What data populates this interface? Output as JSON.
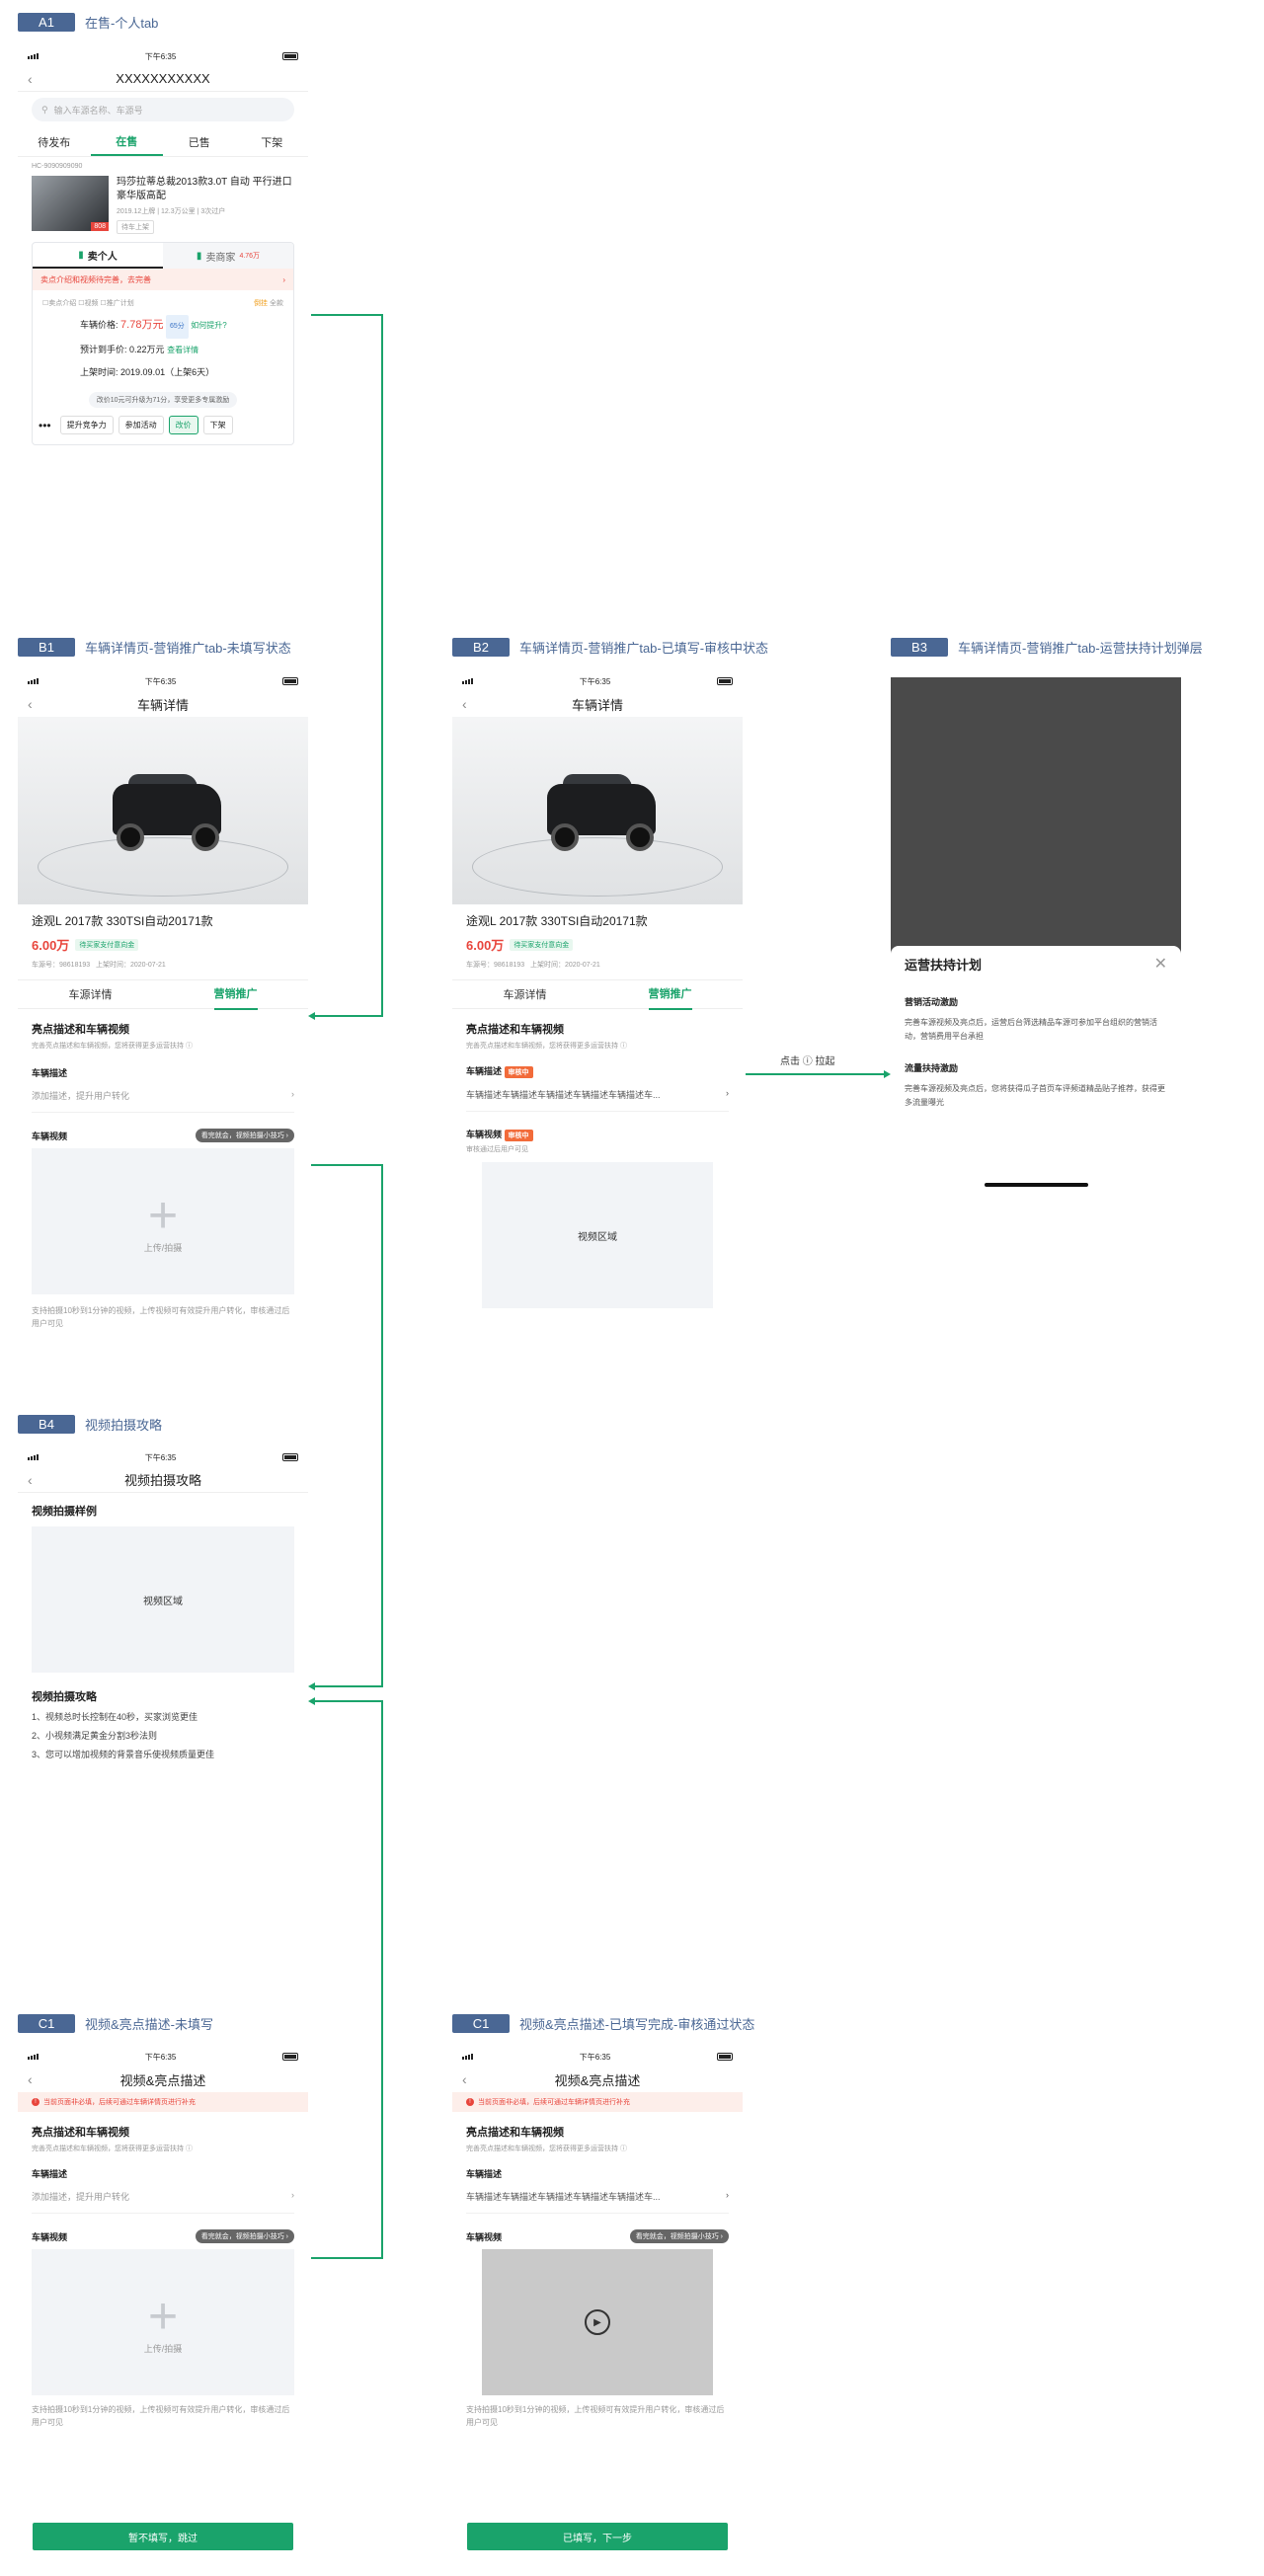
{
  "a1": {
    "tag": "A1",
    "title": "在售-个人tab",
    "time": "下午6:35",
    "nav_title": "XXXXXXXXXXX",
    "search_placeholder": "输入车源名称、车源号",
    "tabs": [
      "待发布",
      "在售",
      "已售",
      "下架"
    ],
    "car_id": "HC-9090909090",
    "car_name": "玛莎拉蒂总裁2013款3.0T 自动 平行进口 豪华版高配",
    "car_meta": "2019.12上牌 | 12.3万公里 | 3次过户",
    "car_badge": "待车上架",
    "price_tag": "808",
    "sell_tabs": [
      "卖个人",
      "卖商家"
    ],
    "dealer_price": "4.76万",
    "warn": "卖点介绍和视频待完善，去完善",
    "checks": [
      "卖点介绍",
      "视频",
      "推广计划"
    ],
    "status_tags": [
      "倒挂",
      "全款"
    ],
    "price_label": "车辆价格:",
    "price": "7.78万元",
    "price_badge": "65分",
    "price_link": "如何提升?",
    "expect_label": "预计到手价:",
    "expect": "0.22万元",
    "expect_link": "查看详情",
    "listed_label": "上架时间:",
    "listed": "2019.09.01（上架6天）",
    "hint": "改价10元可升级为71分，享受更多专属激励",
    "actions": [
      "提升竞争力",
      "参加活动",
      "改价",
      "下架"
    ]
  },
  "b1": {
    "tag": "B1",
    "title": "车辆详情页-营销推广tab-未填写状态",
    "nav_title": "车辆详情",
    "car_title": "途观L 2017款 330TSI自动20171款",
    "price": "6.00万",
    "chip": "待买家支付意向金",
    "car_no": "车源号：98618193",
    "listed": "上架时间：2020-07-21",
    "tabs": [
      "车源详情",
      "营销推广"
    ],
    "sec_title": "亮点描述和车辆视频",
    "sec_sub": "完善亮点描述和车辆视频，您将获得更多运营扶持",
    "desc_label": "车辆描述",
    "desc_placeholder": "添加描述，提升用户转化",
    "video_label": "车辆视频",
    "video_pill": "看完就会，视频拍摄小技巧",
    "upload_text": "上传/拍摄",
    "note": "支持拍摄10秒到1分钟的视频，上传视频可有效提升用户转化，审核通过后用户可见"
  },
  "b2": {
    "tag": "B2",
    "title": "车辆详情页-营销推广tab-已填写-审核中状态",
    "desc_label": "车辆描述",
    "review": "审核中",
    "desc_text": "车辆描述车辆描述车辆描述车辆描述车辆描述车...",
    "video_label": "车辆视频",
    "video_sub": "审核通过后用户可见",
    "video_area": "视频区域",
    "click_label": "点击 ⓘ 拉起"
  },
  "b3": {
    "tag": "B3",
    "title": "车辆详情页-营销推广tab-运营扶持计划弹层",
    "sheet_title": "运营扶持计划",
    "s1_title": "营销活动激励",
    "s1_text": "完善车源视频及亮点后，运营后台筛选精品车源可参加平台组织的营销活动，营销费用平台承担",
    "s2_title": "流量扶持激励",
    "s2_text": "完善车源视频及亮点后，您将获得瓜子首页车评频道精品贴子推荐，获得更多流量曝光"
  },
  "b4": {
    "tag": "B4",
    "title": "视频拍摄攻略",
    "nav_title": "视频拍摄攻略",
    "sample_title": "视频拍摄样例",
    "video_area": "视频区域",
    "guide_title": "视频拍摄攻略",
    "guide": [
      "1、视频总时长控制在40秒，买家浏览更佳",
      "2、小视频满足黄金分割3秒法则",
      "3、您可以增加视频的背景音乐使视频质量更佳"
    ]
  },
  "c1": {
    "tag": "C1",
    "title": "视频&亮点描述-未填写",
    "nav_title": "视频&亮点描述",
    "warn": "当前页面非必填，后续可通过车辆详情页进行补充",
    "button": "暂不填写，跳过"
  },
  "c2": {
    "tag": "C1",
    "title": "视频&亮点描述-已填写完成-审核通过状态",
    "button": "已填写，下一步"
  }
}
